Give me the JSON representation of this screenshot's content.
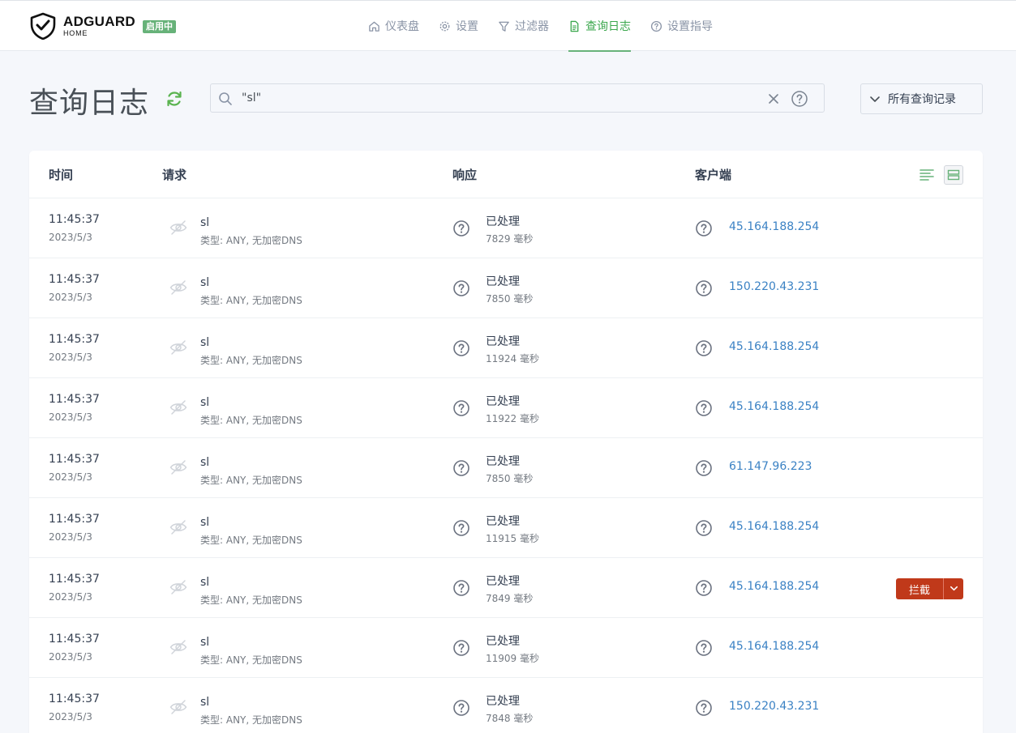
{
  "header": {
    "logo_main": "ADGUARD",
    "logo_sub": "HOME",
    "status_badge": "启用中",
    "nav": [
      {
        "label": "仪表盘",
        "icon": "home-icon"
      },
      {
        "label": "设置",
        "icon": "gear-icon"
      },
      {
        "label": "过滤器",
        "icon": "filter-icon"
      },
      {
        "label": "查询日志",
        "icon": "document-icon",
        "active": true
      },
      {
        "label": "设置指导",
        "icon": "help-circle-icon"
      }
    ]
  },
  "page": {
    "title": "查询日志",
    "search_value": "\"sl\"",
    "filter_label": "所有查询记录"
  },
  "table": {
    "columns": {
      "time": "时间",
      "request": "请求",
      "response": "响应",
      "client": "客户端"
    },
    "block_label": "拦截",
    "rows": [
      {
        "time": "11:45:37",
        "date": "2023/5/3",
        "domain": "sl",
        "type": "类型: ANY, 无加密DNS",
        "status": "已处理",
        "elapsed": "7829 毫秒",
        "client": "45.164.188.254"
      },
      {
        "time": "11:45:37",
        "date": "2023/5/3",
        "domain": "sl",
        "type": "类型: ANY, 无加密DNS",
        "status": "已处理",
        "elapsed": "7850 毫秒",
        "client": "150.220.43.231"
      },
      {
        "time": "11:45:37",
        "date": "2023/5/3",
        "domain": "sl",
        "type": "类型: ANY, 无加密DNS",
        "status": "已处理",
        "elapsed": "11924 毫秒",
        "client": "45.164.188.254"
      },
      {
        "time": "11:45:37",
        "date": "2023/5/3",
        "domain": "sl",
        "type": "类型: ANY, 无加密DNS",
        "status": "已处理",
        "elapsed": "11922 毫秒",
        "client": "45.164.188.254"
      },
      {
        "time": "11:45:37",
        "date": "2023/5/3",
        "domain": "sl",
        "type": "类型: ANY, 无加密DNS",
        "status": "已处理",
        "elapsed": "7850 毫秒",
        "client": "61.147.96.223"
      },
      {
        "time": "11:45:37",
        "date": "2023/5/3",
        "domain": "sl",
        "type": "类型: ANY, 无加密DNS",
        "status": "已处理",
        "elapsed": "11915 毫秒",
        "client": "45.164.188.254"
      },
      {
        "time": "11:45:37",
        "date": "2023/5/3",
        "domain": "sl",
        "type": "类型: ANY, 无加密DNS",
        "status": "已处理",
        "elapsed": "7849 毫秒",
        "client": "45.164.188.254",
        "hovered": true
      },
      {
        "time": "11:45:37",
        "date": "2023/5/3",
        "domain": "sl",
        "type": "类型: ANY, 无加密DNS",
        "status": "已处理",
        "elapsed": "11909 毫秒",
        "client": "45.164.188.254"
      },
      {
        "time": "11:45:37",
        "date": "2023/5/3",
        "domain": "sl",
        "type": "类型: ANY, 无加密DNS",
        "status": "已处理",
        "elapsed": "7848 毫秒",
        "client": "150.220.43.231"
      }
    ]
  },
  "colors": {
    "accent": "#67b279",
    "link": "#3b82c4",
    "danger": "#c0391a"
  }
}
